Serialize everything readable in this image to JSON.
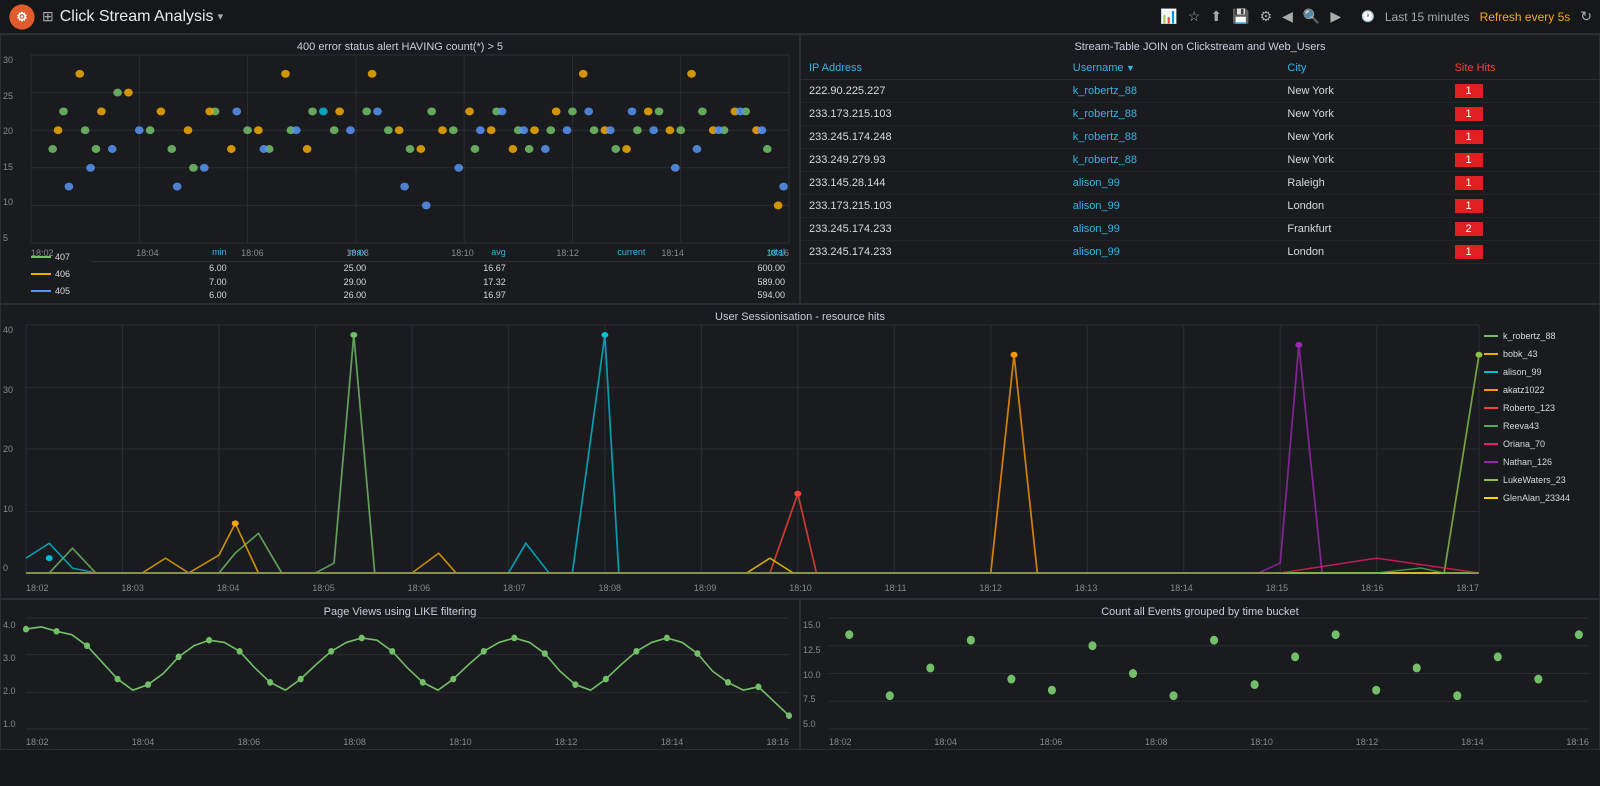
{
  "topbar": {
    "title": "Click Stream Analysis",
    "dropdown_icon": "▾",
    "time_label": "Last 15 minutes",
    "refresh_label": "Refresh every 5s"
  },
  "panel1": {
    "title": "400 error status alert HAVING count(*) > 5",
    "y_labels": [
      "30",
      "25",
      "20",
      "15",
      "10",
      "5"
    ],
    "x_labels": [
      "18:02",
      "18:04",
      "18:06",
      "18:08",
      "18:10",
      "18:12",
      "18:14",
      "18:16"
    ],
    "stats": {
      "headers": [
        "min",
        "max",
        "avg",
        "current",
        "total"
      ],
      "rows": [
        {
          "label": "407",
          "color": "#73bf69",
          "min": "6.00",
          "max": "25.00",
          "avg": "16.67",
          "current": "",
          "total": "600.00"
        },
        {
          "label": "406",
          "color": "#f2a900",
          "min": "7.00",
          "max": "29.00",
          "avg": "17.32",
          "current": "",
          "total": "589.00"
        },
        {
          "label": "405",
          "color": "#5794f2",
          "min": "6.00",
          "max": "26.00",
          "avg": "16.97",
          "current": "",
          "total": "594.00"
        }
      ]
    }
  },
  "panel2": {
    "title": "Stream-Table JOIN on Clickstream and Web_Users",
    "headers": [
      "IP Address",
      "Username",
      "City",
      "Site Hits"
    ],
    "rows": [
      {
        "ip": "222.90.225.227",
        "username": "k_robertz_88",
        "city": "New York",
        "hits": "1"
      },
      {
        "ip": "233.173.215.103",
        "username": "k_robertz_88",
        "city": "New York",
        "hits": "1"
      },
      {
        "ip": "233.245.174.248",
        "username": "k_robertz_88",
        "city": "New York",
        "hits": "1"
      },
      {
        "ip": "233.249.279.93",
        "username": "k_robertz_88",
        "city": "New York",
        "hits": "1"
      },
      {
        "ip": "233.145.28.144",
        "username": "alison_99",
        "city": "Raleigh",
        "hits": "1"
      },
      {
        "ip": "233.173.215.103",
        "username": "alison_99",
        "city": "London",
        "hits": "1"
      },
      {
        "ip": "233.245.174.233",
        "username": "alison_99",
        "city": "Frankfurt",
        "hits": "2"
      },
      {
        "ip": "233.245.174.233",
        "username": "alison_99",
        "city": "London",
        "hits": "1"
      }
    ]
  },
  "panel3": {
    "title": "User Sessionisation - resource hits",
    "y_labels": [
      "40",
      "30",
      "20",
      "10",
      "0"
    ],
    "x_labels": [
      "18:02",
      "18:03",
      "18:04",
      "18:05",
      "18:06",
      "18:07",
      "18:08",
      "18:09",
      "18:10",
      "18:11",
      "18:12",
      "18:13",
      "18:14",
      "18:15",
      "18:16",
      "18:17"
    ],
    "legend": [
      {
        "label": "k_robertz_88",
        "color": "#73bf69"
      },
      {
        "label": "bobk_43",
        "color": "#f2a900"
      },
      {
        "label": "alison_99",
        "color": "#00bcd4"
      },
      {
        "label": "akatz1022",
        "color": "#ff9800"
      },
      {
        "label": "Roberto_123",
        "color": "#f44336"
      },
      {
        "label": "Reeva43",
        "color": "#4caf50"
      },
      {
        "label": "Oriana_70",
        "color": "#e91e63"
      },
      {
        "label": "Nathan_126",
        "color": "#9c27b0"
      },
      {
        "label": "LukeWaters_23",
        "color": "#8bc34a"
      },
      {
        "label": "GlenAlan_23344",
        "color": "#ffd600"
      }
    ]
  },
  "panel4": {
    "title": "Page Views using LIKE filtering",
    "y_labels": [
      "4.0",
      "3.0",
      "2.0",
      "1.0"
    ],
    "x_labels": [
      "18:02",
      "18:04",
      "18:06",
      "18:08",
      "18:10",
      "18:12",
      "18:14",
      "18:16"
    ]
  },
  "panel5": {
    "title": "Count all Events grouped by time bucket",
    "y_labels": [
      "15.0",
      "12.5",
      "10.0",
      "7.5",
      "5.0"
    ],
    "x_labels": [
      "18:02",
      "18:04",
      "18:06",
      "18:08",
      "18:10",
      "18:12",
      "18:14",
      "18:16"
    ]
  }
}
